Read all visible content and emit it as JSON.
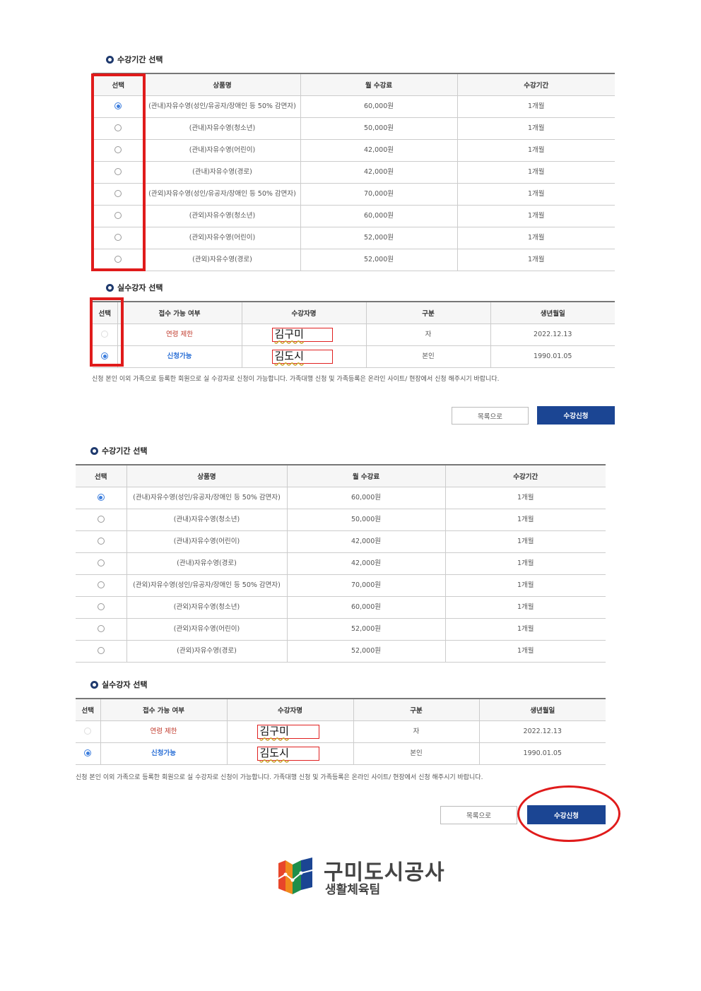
{
  "course_section": {
    "title": "수강기간 선택",
    "headers": [
      "선택",
      "상품명",
      "월 수강료",
      "수강기간"
    ],
    "rows": [
      {
        "selected": true,
        "product": "(관내)자유수영(성인/유공자/장애인 등 50% 감면자)",
        "fee": "60,000원",
        "period": "1개월"
      },
      {
        "selected": false,
        "product": "(관내)자유수영(청소년)",
        "fee": "50,000원",
        "period": "1개월"
      },
      {
        "selected": false,
        "product": "(관내)자유수영(어린이)",
        "fee": "42,000원",
        "period": "1개월"
      },
      {
        "selected": false,
        "product": "(관내)자유수영(경로)",
        "fee": "42,000원",
        "period": "1개월"
      },
      {
        "selected": false,
        "product": "(관외)자유수영(성인/유공자/장애인 등 50% 감면자)",
        "fee": "70,000원",
        "period": "1개월"
      },
      {
        "selected": false,
        "product": "(관외)자유수영(청소년)",
        "fee": "60,000원",
        "period": "1개월"
      },
      {
        "selected": false,
        "product": "(관외)자유수영(어린이)",
        "fee": "52,000원",
        "period": "1개월"
      },
      {
        "selected": false,
        "product": "(관외)자유수영(경로)",
        "fee": "52,000원",
        "period": "1개월"
      }
    ]
  },
  "student_section": {
    "title": "실수강자 선택",
    "headers": [
      "선택",
      "접수 가능 여부",
      "수강자명",
      "구분",
      "생년월일"
    ],
    "rows": [
      {
        "state": "disabled",
        "status": "연령 제한",
        "status_type": "limit",
        "name": "김구미",
        "relation": "자",
        "birth": "2022.12.13"
      },
      {
        "state": "selected",
        "status": "신청가능",
        "status_type": "ok",
        "name": "김도시",
        "relation": "본인",
        "birth": "1990.01.05"
      }
    ]
  },
  "notice": "신청 본인 이외 가족으로 등록한 회원으로 실 수강자로 신청이 가능합니다. 가족대행 신청 및 가족등록은 온라인 사이트/ 현장에서 신청 해주시기 바랍니다.",
  "buttons": {
    "list": "목록으로",
    "apply": "수강신청"
  },
  "logo": {
    "main": "구미도시공사",
    "sub": "생활체육팀"
  },
  "colors": {
    "accent": "#1b4593",
    "highlight": "#e01b1b",
    "radio": "#3b7ddd"
  }
}
